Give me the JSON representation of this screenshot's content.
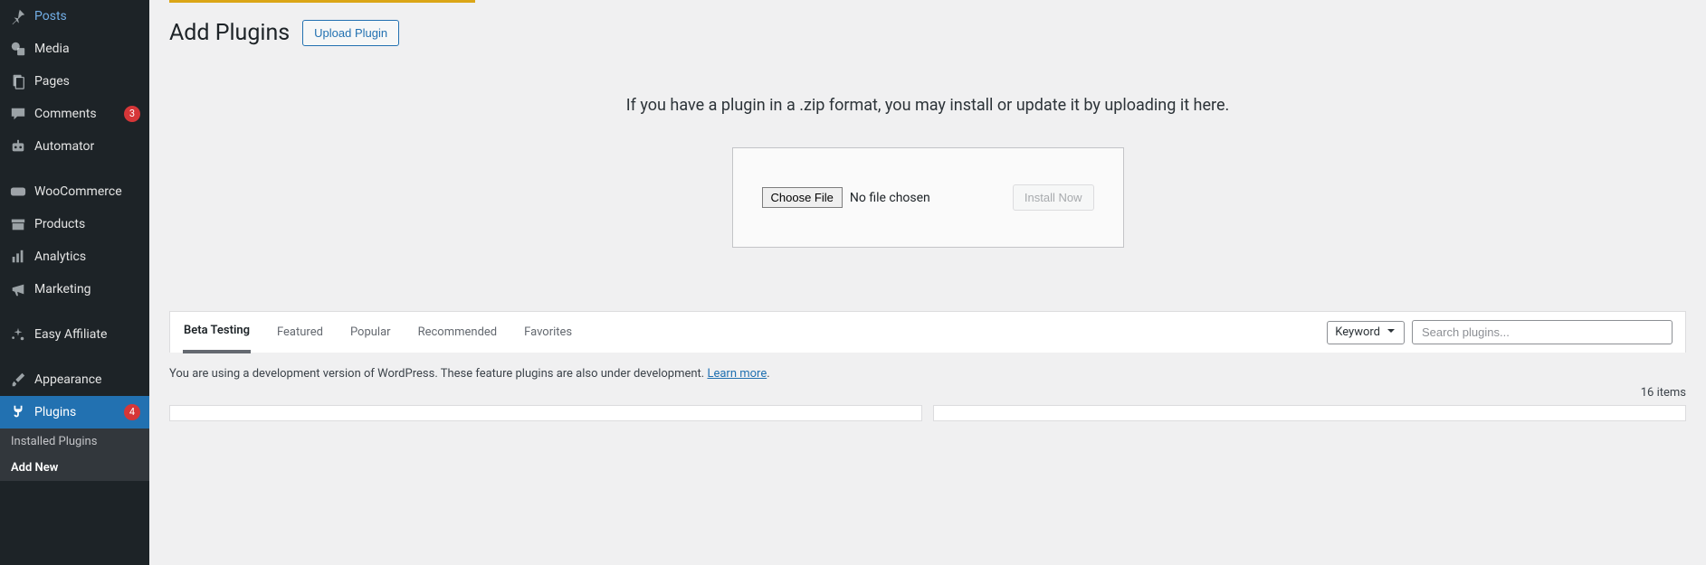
{
  "sidebar": {
    "items": [
      {
        "label": "Posts"
      },
      {
        "label": "Media"
      },
      {
        "label": "Pages"
      },
      {
        "label": "Comments",
        "badge": "3"
      },
      {
        "label": "Automator"
      },
      {
        "label": "WooCommerce"
      },
      {
        "label": "Products"
      },
      {
        "label": "Analytics"
      },
      {
        "label": "Marketing"
      },
      {
        "label": "Easy Affiliate"
      },
      {
        "label": "Appearance"
      },
      {
        "label": "Plugins",
        "badge": "4"
      }
    ],
    "submenu": [
      {
        "label": "Installed Plugins"
      },
      {
        "label": "Add New"
      }
    ]
  },
  "header": {
    "title": "Add Plugins",
    "upload_button": "Upload Plugin"
  },
  "upload": {
    "instruction": "If you have a plugin in a .zip format, you may install or update it by uploading it here.",
    "choose_file": "Choose File",
    "file_status": "No file chosen",
    "install_button": "Install Now"
  },
  "filters": {
    "tabs": [
      "Beta Testing",
      "Featured",
      "Popular",
      "Recommended",
      "Favorites"
    ],
    "select_label": "Keyword",
    "search_placeholder": "Search plugins..."
  },
  "info": {
    "text": "You are using a development version of WordPress. These feature plugins are also under development. ",
    "link": "Learn more",
    "period": "."
  },
  "results": {
    "count": "16 items"
  }
}
